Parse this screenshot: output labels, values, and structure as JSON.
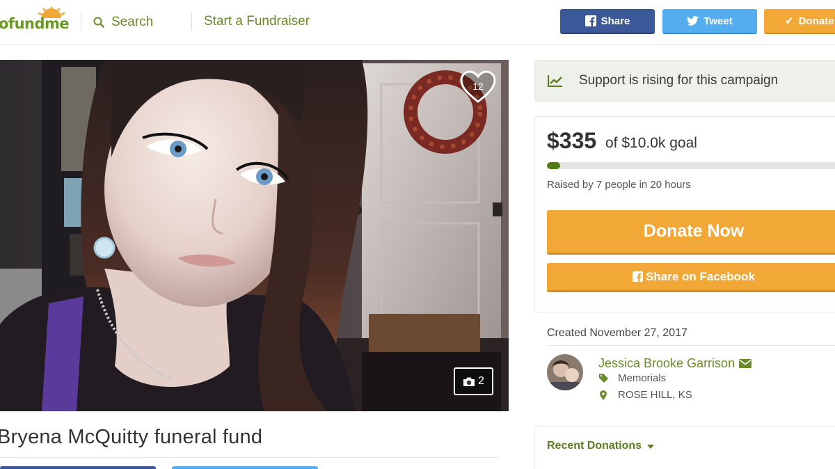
{
  "header": {
    "logo_text": "ofundme",
    "search_label": "Search",
    "start_label": "Start a Fundraiser",
    "share_label": "Share",
    "tweet_label": "Tweet",
    "donate_label": "Donate"
  },
  "hero": {
    "favorites_count": "12",
    "photo_count": "2"
  },
  "campaign": {
    "title": "Bryena McQuitty funeral fund"
  },
  "sidebar": {
    "rising_text": "Support is rising for this campaign",
    "amount": "$335",
    "goal_text": "of $10.0k goal",
    "progress_fraction": 0.034,
    "raised_text": "Raised by 7 people in 20 hours",
    "donate_now_label": "Donate Now",
    "share_fb_label": "Share on Facebook",
    "created_text": "Created November 27, 2017",
    "organizer_name": "Jessica Brooke Garrison",
    "category": "Memorials",
    "location": "ROSE HILL, KS",
    "recent_donations_label": "Recent Donations"
  },
  "colors": {
    "brand_green": "#6a8a2b",
    "facebook_blue": "#3b5998",
    "twitter_blue": "#55acee",
    "donate_orange": "#f1a836",
    "progress_green": "#4f7d12"
  },
  "icons": [
    "sun-logo-icon",
    "search-icon",
    "facebook-icon",
    "twitter-icon",
    "check-icon",
    "heart-icon",
    "camera-icon",
    "trend-chart-icon",
    "envelope-icon",
    "tag-icon",
    "map-pin-icon",
    "caret-down-icon"
  ]
}
